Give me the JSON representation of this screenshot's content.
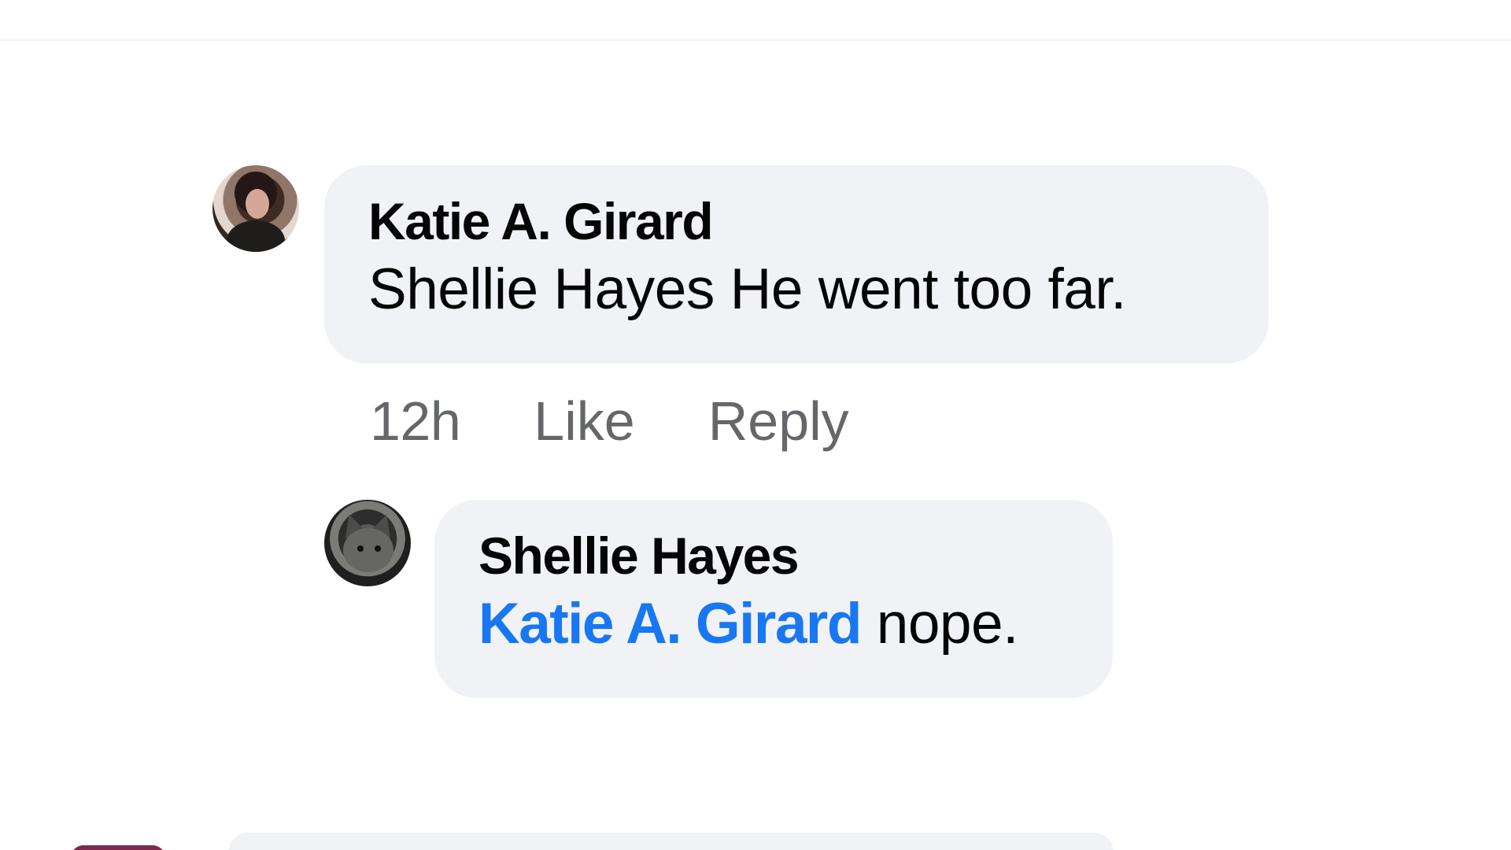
{
  "comments": {
    "top": {
      "author": "Katie A. Girard",
      "text": "Shellie Hayes He went too far.",
      "actions": {
        "time": "12h",
        "like": "Like",
        "reply": "Reply"
      },
      "avatar_icon": "katie-avatar"
    },
    "reply": {
      "author": "Shellie Hayes",
      "mention": "Katie A. Girard",
      "text": " nope.",
      "avatar_icon": "cat-avatar"
    }
  },
  "colors": {
    "bubble_background": "#f0f2f5",
    "link_blue": "#1877f2",
    "secondary_text": "#65676b",
    "primary_text": "#050505"
  }
}
